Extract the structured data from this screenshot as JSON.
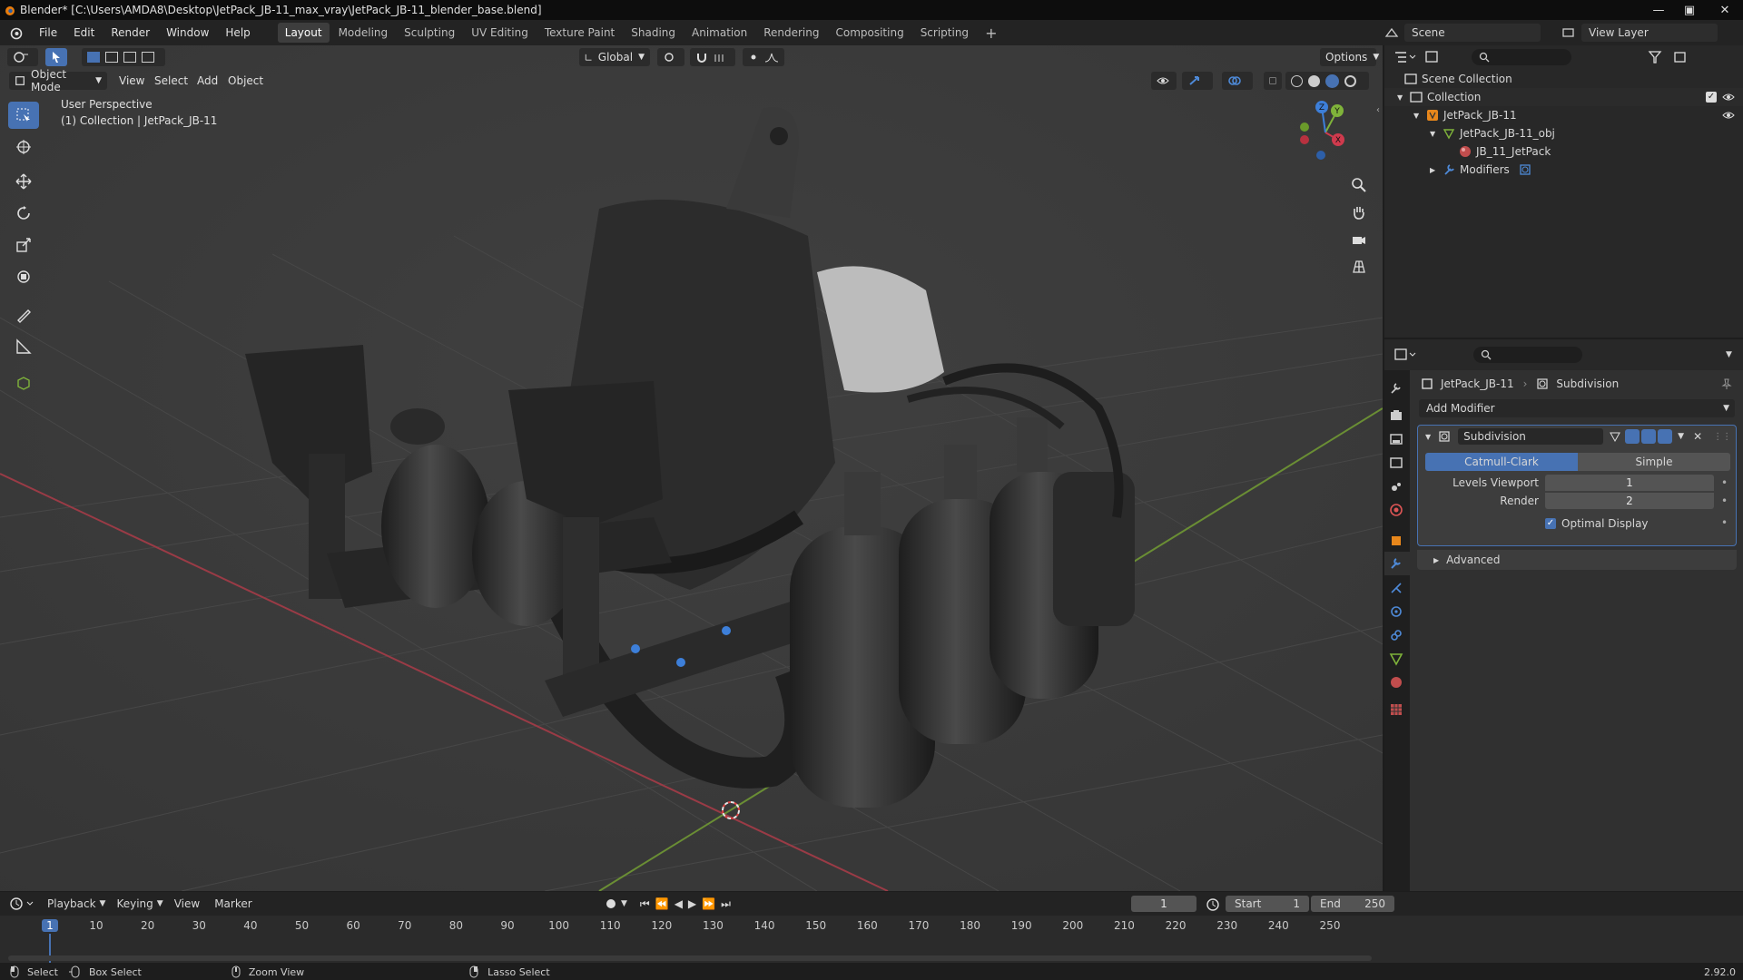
{
  "window": {
    "title": "Blender* [C:\\Users\\AMDA8\\Desktop\\JetPack_JB-11_max_vray\\JetPack_JB-11_blender_base.blend]"
  },
  "menus": [
    "File",
    "Edit",
    "Render",
    "Window",
    "Help"
  ],
  "workspaces": [
    "Layout",
    "Modeling",
    "Sculpting",
    "UV Editing",
    "Texture Paint",
    "Shading",
    "Animation",
    "Rendering",
    "Compositing",
    "Scripting"
  ],
  "active_workspace": "Layout",
  "scene": {
    "label": "Scene",
    "view_layer": "View Layer"
  },
  "viewport": {
    "transform_orientation": "Global",
    "options_label": "Options",
    "mode": "Object Mode",
    "menu": [
      "View",
      "Select",
      "Add",
      "Object"
    ],
    "overlay_title": "User Perspective",
    "overlay_subtitle": "(1) Collection | JetPack_JB-11",
    "gizmo_labels": {
      "z": "Z",
      "y": "Y",
      "x": "X"
    }
  },
  "outliner": {
    "rows": [
      {
        "label": "Scene Collection",
        "indent": 0
      },
      {
        "label": "Collection",
        "indent": 1
      },
      {
        "label": "JetPack_JB-11",
        "indent": 2
      },
      {
        "label": "JetPack_JB-11_obj",
        "indent": 3
      },
      {
        "label": "JB_11_JetPack",
        "indent": 4
      },
      {
        "label": "Modifiers",
        "indent": 3
      }
    ]
  },
  "properties": {
    "object_name": "JetPack_JB-11",
    "modifier_context": "Subdivision",
    "add_modifier": "Add Modifier",
    "modifier": {
      "name": "Subdivision",
      "mode_a": "Catmull-Clark",
      "mode_b": "Simple",
      "levels_viewport_label": "Levels Viewport",
      "levels_viewport": "1",
      "render_label": "Render",
      "render": "2",
      "optimal_display": "Optimal Display",
      "advanced": "Advanced"
    }
  },
  "timeline": {
    "menu": [
      "Playback",
      "Keying",
      "View",
      "Marker"
    ],
    "current_frame": "1",
    "start_label": "Start",
    "start": "1",
    "end_label": "End",
    "end": "250",
    "ticks": [
      "1",
      "10",
      "20",
      "30",
      "40",
      "50",
      "60",
      "70",
      "80",
      "90",
      "100",
      "110",
      "120",
      "130",
      "140",
      "150",
      "160",
      "170",
      "180",
      "190",
      "200",
      "210",
      "220",
      "230",
      "240",
      "250"
    ]
  },
  "status": {
    "select": "Select",
    "box_select": "Box Select",
    "zoom_view": "Zoom View",
    "lasso_select": "Lasso Select",
    "version": "2.92.0"
  },
  "colors": {
    "accent": "#4772b3",
    "x_axis": "#cf3a4d",
    "y_axis": "#7fb33a",
    "z_axis": "#3d7fd9"
  }
}
